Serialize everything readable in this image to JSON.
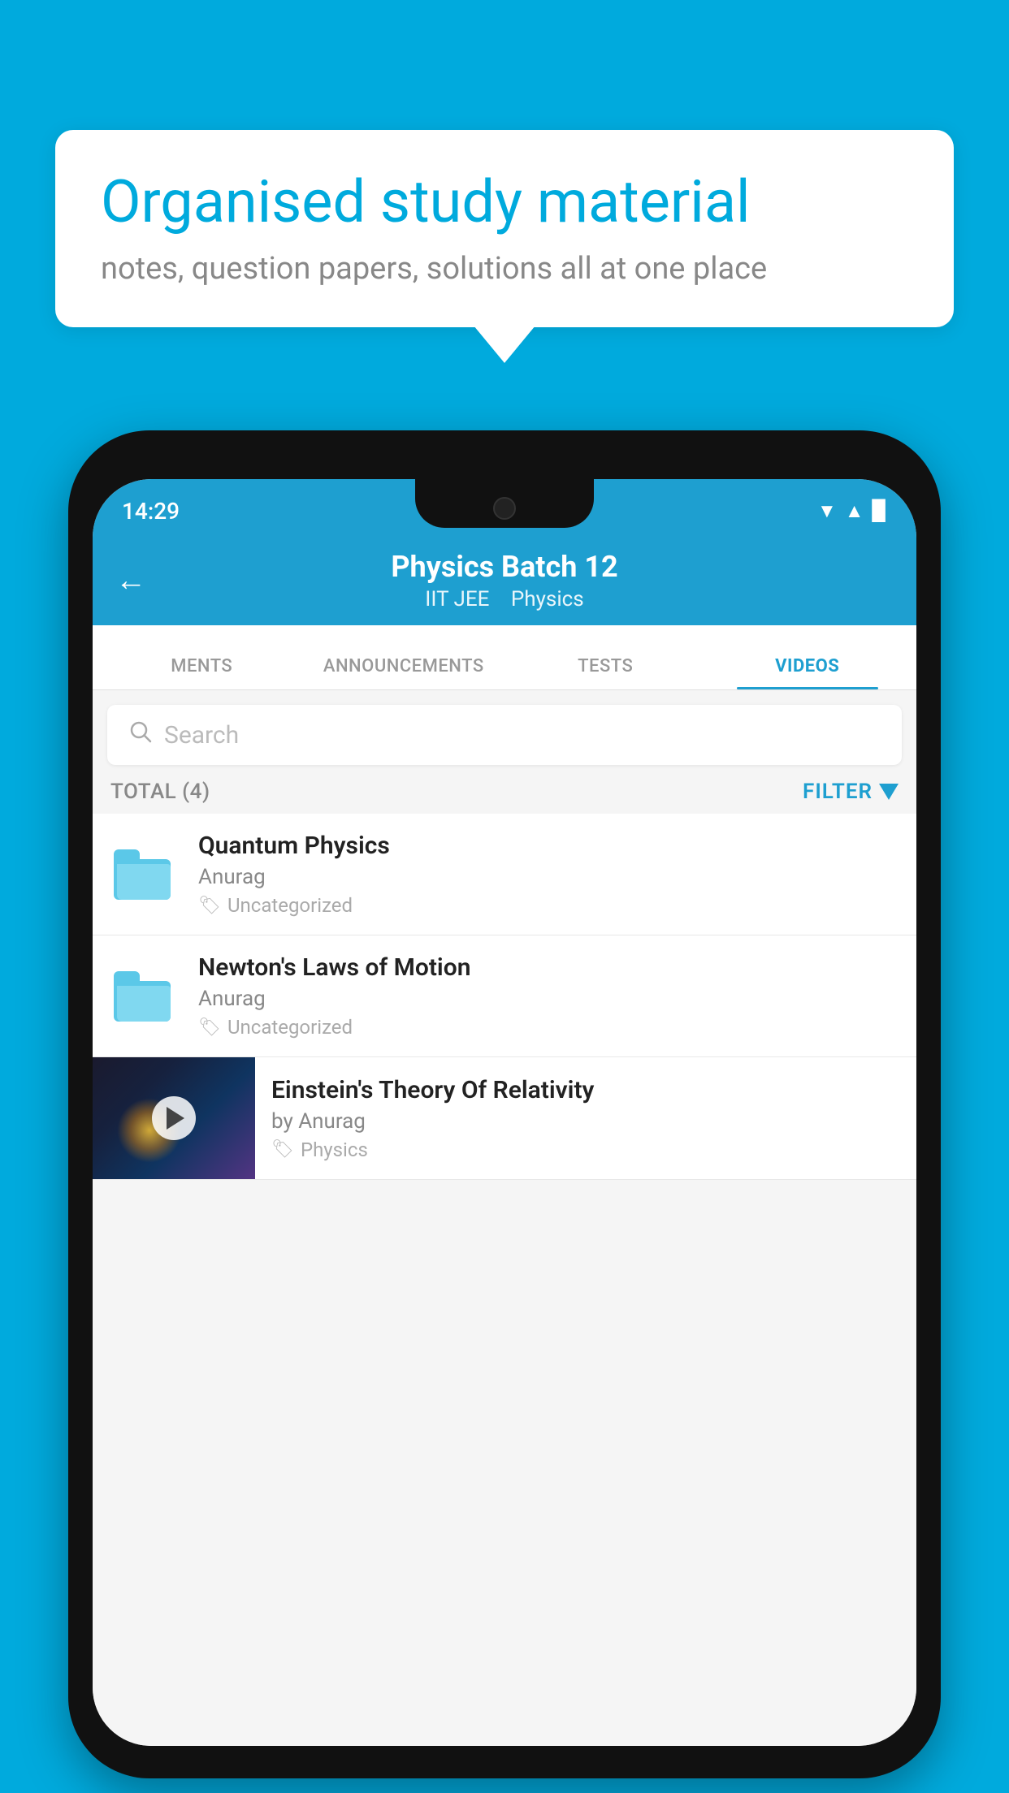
{
  "background_color": "#00AADD",
  "speech_bubble": {
    "title": "Organised study material",
    "subtitle": "notes, question papers, solutions all at one place"
  },
  "status_bar": {
    "time": "14:29",
    "wifi": "▼",
    "signal": "▲",
    "battery": "▉"
  },
  "app_header": {
    "title": "Physics Batch 12",
    "subtitle_part1": "IIT JEE",
    "subtitle_part2": "Physics",
    "back_icon": "←"
  },
  "tabs": [
    {
      "label": "MENTS",
      "active": false
    },
    {
      "label": "ANNOUNCEMENTS",
      "active": false
    },
    {
      "label": "TESTS",
      "active": false
    },
    {
      "label": "VIDEOS",
      "active": true
    }
  ],
  "search": {
    "placeholder": "Search"
  },
  "filter_row": {
    "total_label": "TOTAL (4)",
    "filter_label": "FILTER"
  },
  "list_items": [
    {
      "title": "Quantum Physics",
      "author": "Anurag",
      "tag": "Uncategorized",
      "type": "folder"
    },
    {
      "title": "Newton's Laws of Motion",
      "author": "Anurag",
      "tag": "Uncategorized",
      "type": "folder"
    },
    {
      "title": "Einstein's Theory Of Relativity",
      "author": "by Anurag",
      "tag": "Physics",
      "type": "video"
    }
  ]
}
